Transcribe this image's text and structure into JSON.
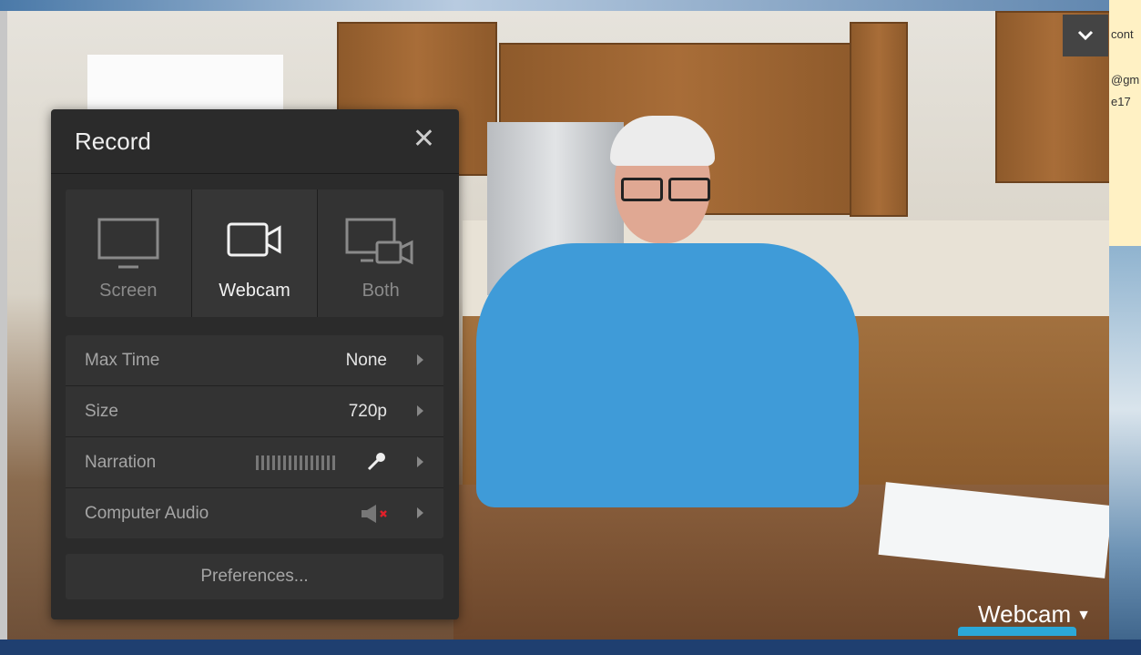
{
  "record_panel": {
    "title": "Record",
    "modes": [
      {
        "label": "Screen",
        "icon": "monitor-icon",
        "selected": false
      },
      {
        "label": "Webcam",
        "icon": "camera-icon",
        "selected": true
      },
      {
        "label": "Both",
        "icon": "monitor-camera-icon",
        "selected": false
      }
    ],
    "settings": {
      "max_time": {
        "label": "Max Time",
        "value": "None"
      },
      "size": {
        "label": "Size",
        "value": "720p"
      },
      "narration": {
        "label": "Narration",
        "icon": "microphone-icon"
      },
      "computer_audio": {
        "label": "Computer Audio",
        "icon": "speaker-muted-icon"
      }
    },
    "preferences_label": "Preferences..."
  },
  "preview": {
    "source_label": "Webcam"
  },
  "right_panel": {
    "lines": [
      "cont",
      "@gm",
      "e17"
    ]
  },
  "colors": {
    "panel_bg": "#2b2b2b",
    "accent": "#2ba8d8",
    "muted_x": "#e0202a"
  }
}
